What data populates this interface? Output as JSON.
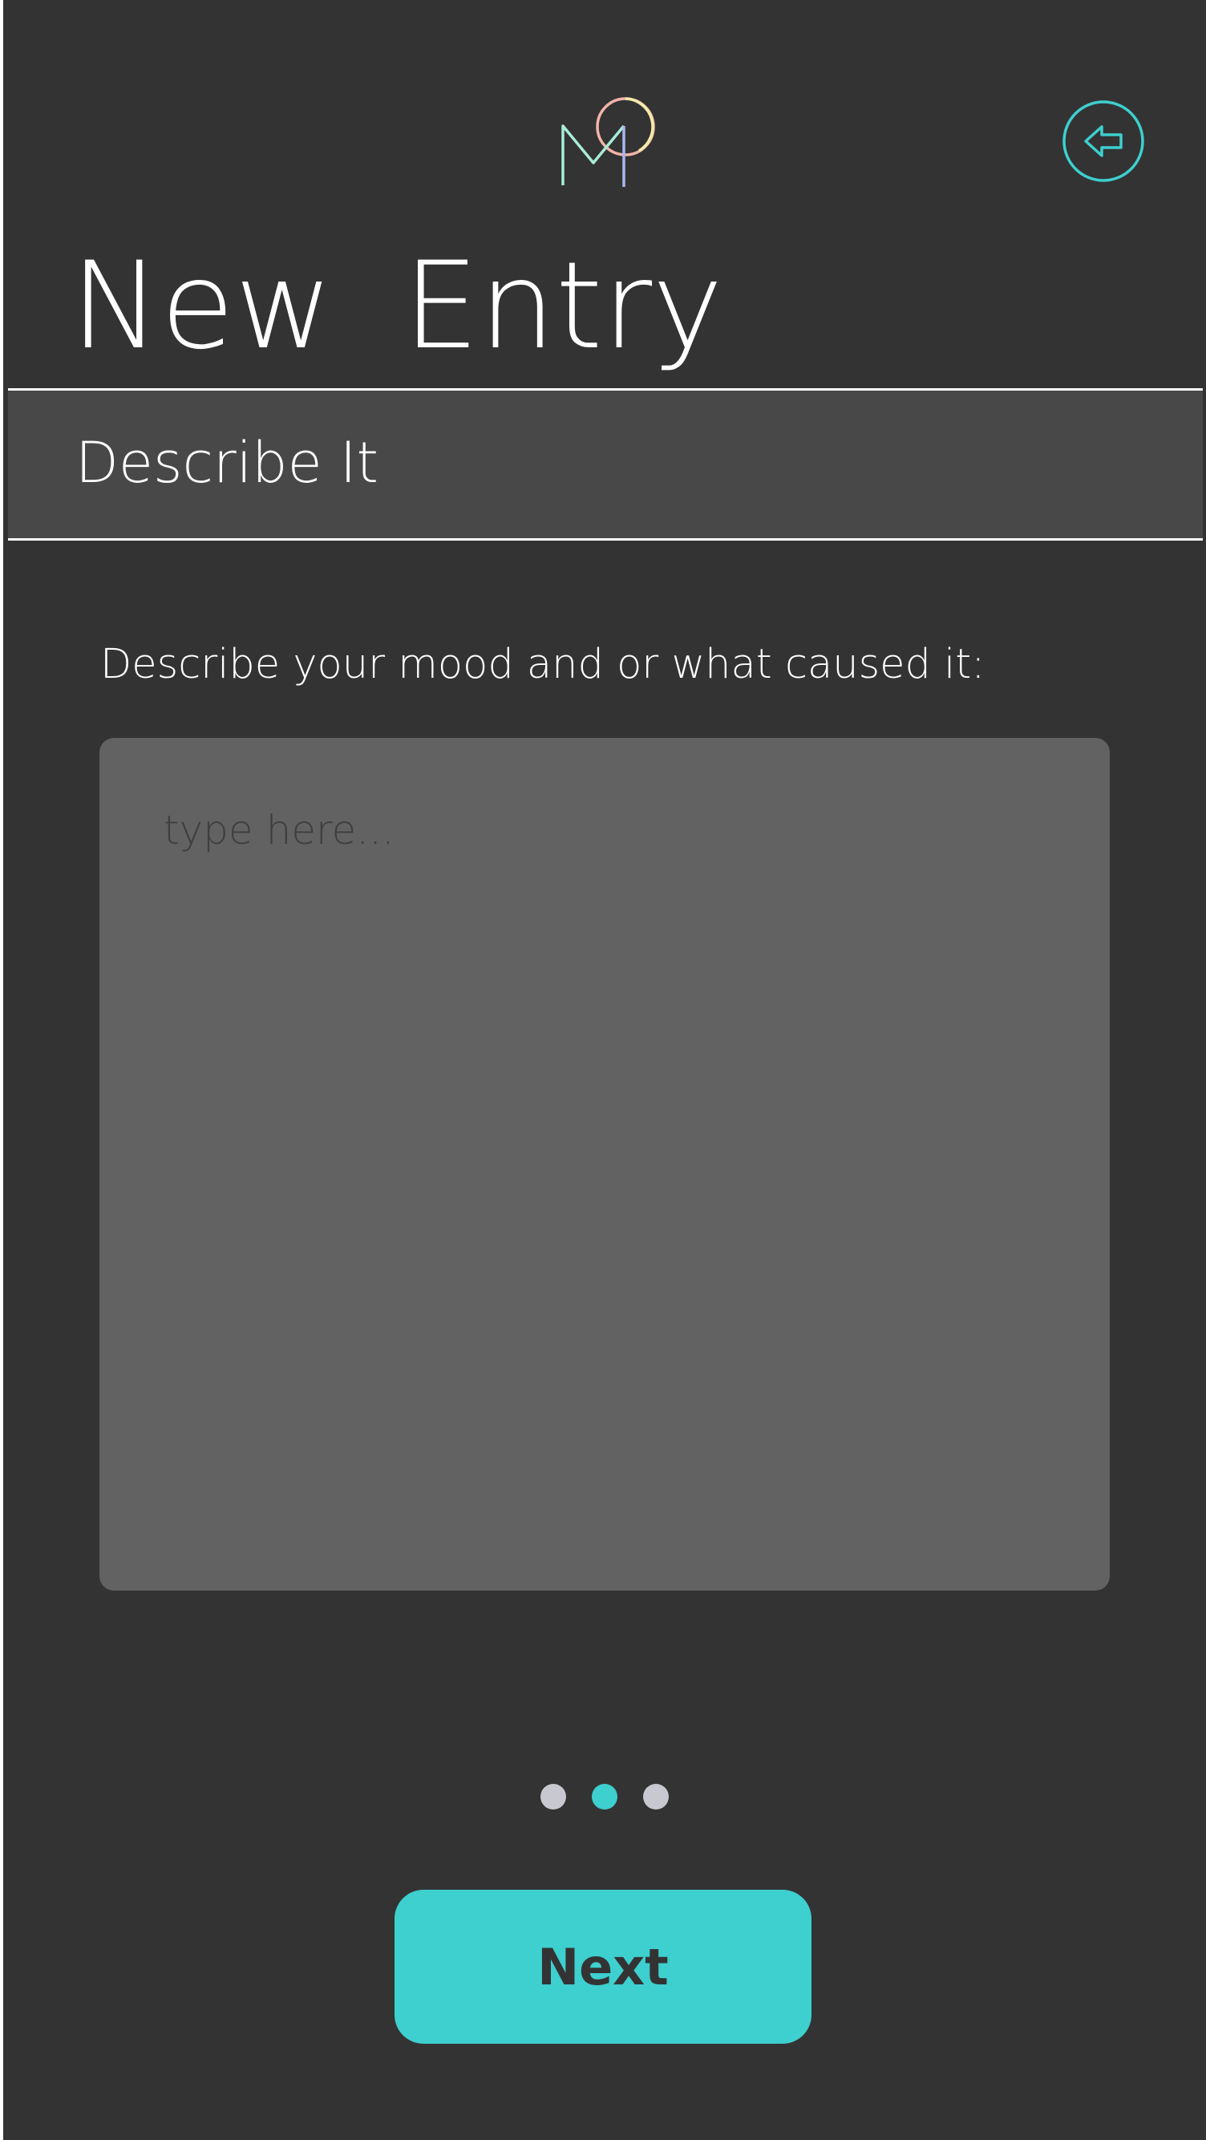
{
  "app": {
    "logo_icon": "mood-logo-icon",
    "back_icon": "back-arrow-icon",
    "accent_color": "#3ecfcf",
    "background_color": "#333333"
  },
  "header": {
    "title": "New Entry"
  },
  "section": {
    "title": "Describe It"
  },
  "form": {
    "prompt": "Describe your mood and or what caused it:",
    "textarea_placeholder": "type here...",
    "textarea_value": ""
  },
  "pagination": {
    "total_steps": 3,
    "current_step": 2
  },
  "actions": {
    "next_label": "Next"
  }
}
